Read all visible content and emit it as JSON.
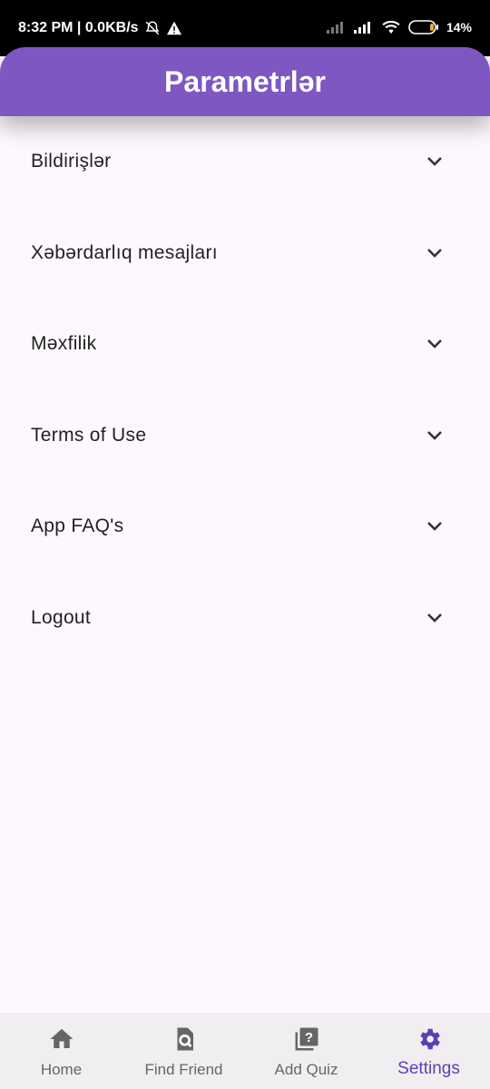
{
  "status_bar": {
    "time_speed": "8:32 PM | 0.0KB/s",
    "battery": "14%",
    "icons": [
      "bell-off-icon",
      "warning-icon",
      "signal-icon",
      "wifi-icon",
      "battery-icon"
    ]
  },
  "app_bar": {
    "title": "Parametrlər"
  },
  "settings": {
    "items": [
      {
        "label": "Bildirişlər"
      },
      {
        "label": "Xəbərdarlıq mesajları"
      },
      {
        "label": "Məxfilik"
      },
      {
        "label": "Terms of Use"
      },
      {
        "label": "App FAQ's"
      },
      {
        "label": "Logout"
      }
    ]
  },
  "bottom_nav": {
    "items": [
      {
        "label": "Home",
        "icon": "home-icon"
      },
      {
        "label": "Find Friend",
        "icon": "find-friend-icon"
      },
      {
        "label": "Add Quiz",
        "icon": "add-quiz-icon"
      },
      {
        "label": "Settings",
        "icon": "settings-icon",
        "active": true
      }
    ]
  },
  "colors": {
    "primary": "#7e57c2",
    "active": "#5e3fb0",
    "background": "#fdf8fd",
    "nav_bg": "#f1eef2"
  }
}
